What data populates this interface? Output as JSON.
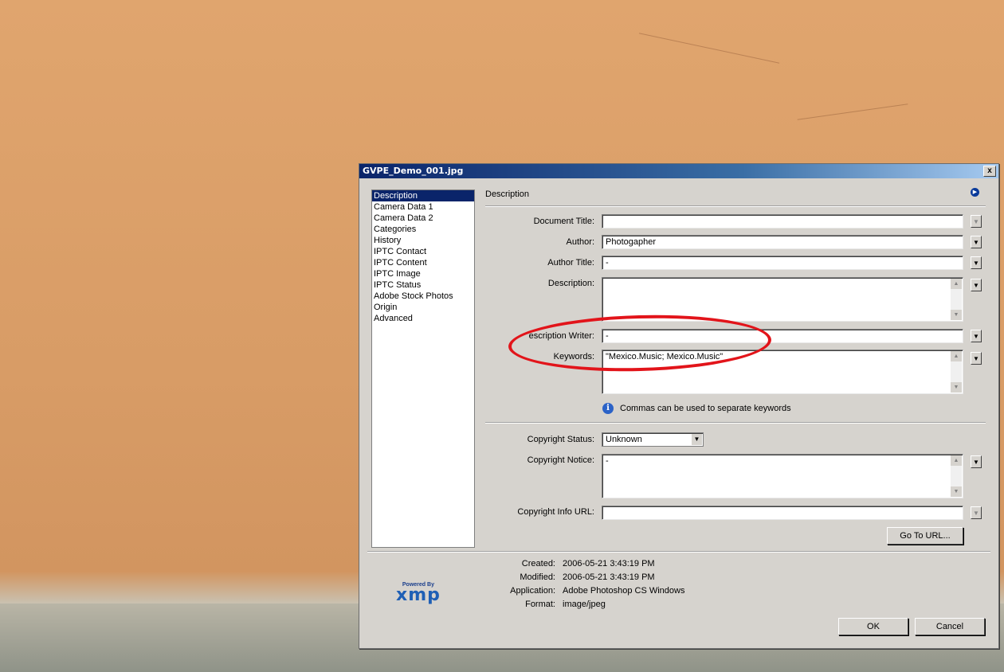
{
  "dialog": {
    "title": "GVPE_Demo_001.jpg",
    "close_label": "x",
    "sidebar": {
      "items": [
        "Description",
        "Camera Data 1",
        "Camera Data 2",
        "Categories",
        "History",
        "IPTC Contact",
        "IPTC Content",
        "IPTC Image",
        "IPTC Status",
        "Adobe Stock Photos",
        "Origin",
        "Advanced"
      ],
      "selected": "Description"
    },
    "section_title": "Description",
    "fields": {
      "document_title": {
        "label": "Document Title:",
        "value": ""
      },
      "author": {
        "label": "Author:",
        "value": "Photogapher"
      },
      "author_title": {
        "label": "Author Title:",
        "value": "-"
      },
      "description": {
        "label": "Description:",
        "value": ""
      },
      "description_writer": {
        "label": "escription Writer:",
        "value": "-"
      },
      "keywords": {
        "label": "Keywords:",
        "value": "\"Mexico.Music; Mexico.Music\""
      },
      "copyright_status": {
        "label": "Copyright Status:",
        "value": "Unknown"
      },
      "copyright_notice": {
        "label": "Copyright Notice:",
        "value": "-"
      },
      "copyright_url": {
        "label": "Copyright Info URL:",
        "value": ""
      }
    },
    "keywords_hint": "Commas can be used to separate keywords",
    "go_to_url_label": "Go To URL...",
    "metadata": {
      "created": {
        "label": "Created:",
        "value": "2006-05-21 3:43:19 PM"
      },
      "modified": {
        "label": "Modified:",
        "value": "2006-05-21 3:43:19 PM"
      },
      "application": {
        "label": "Application:",
        "value": "Adobe Photoshop CS Windows"
      },
      "format": {
        "label": "Format:",
        "value": "image/jpeg"
      }
    },
    "xmp": {
      "powered_by": "Powered By",
      "logo": "xmp"
    },
    "ok_label": "OK",
    "cancel_label": "Cancel"
  },
  "colors": {
    "titlebar": "#0a246a",
    "annotation_circle": "#e2141a",
    "dialog_bg": "#d6d3ce"
  },
  "icons": [
    "close-icon",
    "menu-arrow-icon",
    "dropdown-arrow-icon",
    "info-icon",
    "scroll-up-icon",
    "scroll-down-icon"
  ]
}
